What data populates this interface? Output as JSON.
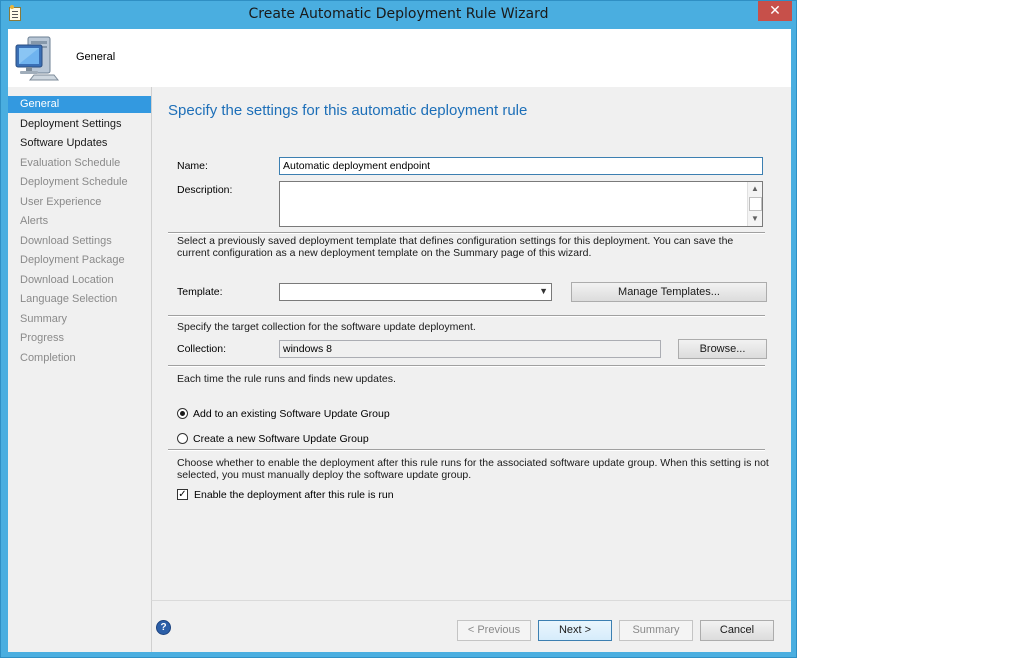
{
  "window": {
    "title": "Create Automatic Deployment Rule Wizard",
    "close_glyph": "✕"
  },
  "header": {
    "title": "General",
    "icon": "computer-icon"
  },
  "sidebar": {
    "items": [
      {
        "label": "General",
        "state": "active"
      },
      {
        "label": "Deployment Settings",
        "state": "done"
      },
      {
        "label": "Software Updates",
        "state": "done"
      },
      {
        "label": "Evaluation Schedule",
        "state": "pending"
      },
      {
        "label": "Deployment Schedule",
        "state": "pending"
      },
      {
        "label": "User Experience",
        "state": "pending"
      },
      {
        "label": "Alerts",
        "state": "pending"
      },
      {
        "label": "Download Settings",
        "state": "pending"
      },
      {
        "label": "Deployment Package",
        "state": "pending"
      },
      {
        "label": "Download Location",
        "state": "pending"
      },
      {
        "label": "Language Selection",
        "state": "pending"
      },
      {
        "label": "Summary",
        "state": "pending"
      },
      {
        "label": "Progress",
        "state": "pending"
      },
      {
        "label": "Completion",
        "state": "pending"
      }
    ]
  },
  "main": {
    "heading": "Specify the settings for this automatic deployment rule",
    "name_label": "Name:",
    "name_value": "Automatic deployment endpoint",
    "description_label": "Description:",
    "description_value": "",
    "template_text": "Select a previously saved deployment template that defines configuration settings for this deployment. You can save the current configuration as a new deployment template on the Summary page of this wizard.",
    "template_label": "Template:",
    "template_value": "",
    "manage_templates_label": "Manage Templates...",
    "collection_text": "Specify the target collection for the software update deployment.",
    "collection_label": "Collection:",
    "collection_value": "windows 8",
    "browse_label": "Browse...",
    "rule_runs_text": "Each time the rule runs and finds new updates.",
    "option_existing_label": "Add to an existing Software Update Group",
    "option_new_label": "Create a new Software Update Group",
    "selected_option": "existing",
    "enable_text": "Choose whether to enable the deployment after this rule runs for the associated software update group. When this setting is not selected, you must manually deploy the software update group.",
    "enable_label": "Enable the deployment after this rule is run",
    "enable_checked": true
  },
  "footer": {
    "previous_label": "< Previous",
    "next_label": "Next >",
    "summary_label": "Summary",
    "cancel_label": "Cancel",
    "help_glyph": "?"
  },
  "colors": {
    "accent": "#3399e0",
    "heading": "#1d6fb8",
    "frame": "#4aaee0",
    "close": "#c7504a"
  }
}
